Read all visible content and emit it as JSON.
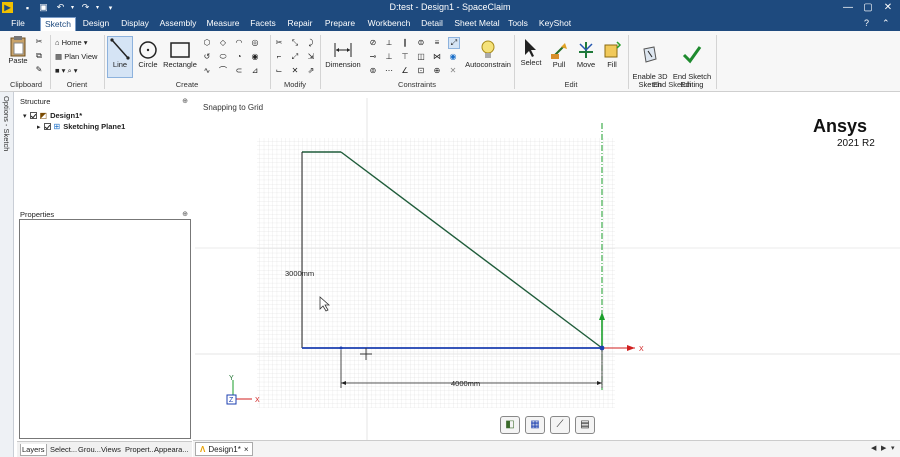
{
  "window": {
    "title": "D:test - Design1 - SpaceClaim"
  },
  "colors": {
    "titlebar": "#1e4a7e",
    "accent_blue": "#1b3fb0",
    "sketch_green": "#1f5c3a",
    "axis_red": "#d01f1f",
    "axis_green": "#1a9e2a",
    "grid": "#d8d8d8"
  },
  "quick_access": [
    "app-icon",
    "new-file-icon",
    "save-icon",
    "undo-icon",
    "redo-icon",
    "customize-icon"
  ],
  "menu": {
    "tabs": [
      "File",
      "Sketch",
      "Design",
      "Display",
      "Assembly",
      "Measure",
      "Facets",
      "Repair",
      "Prepare",
      "Workbench",
      "Detail",
      "Sheet Metal",
      "Tools",
      "KeyShot"
    ],
    "active": "Sketch"
  },
  "ribbon": {
    "clipboard": {
      "label": "Clipboard",
      "paste": "Paste"
    },
    "orient": {
      "label": "Orient",
      "home": "Home",
      "plan_view": "Plan View"
    },
    "create": {
      "label": "Create",
      "line": "Line",
      "circle": "Circle",
      "rectangle": "Rectangle"
    },
    "modify": {
      "label": "Modify"
    },
    "constraints": {
      "label": "Constraints",
      "dimension": "Dimension",
      "autoconstrain": "Autoconstrain"
    },
    "edit": {
      "label": "Edit",
      "select": "Select",
      "pull": "Pull",
      "move": "Move",
      "fill": "Fill"
    },
    "end_sketch": {
      "label": "End Sketch",
      "enable_3d": "Enable 3D\nSketch",
      "end_editing": "End Sketch\nEditing"
    }
  },
  "sidebar": {
    "vertical_tab": "Options - Sketch"
  },
  "structure": {
    "title": "Structure",
    "items": [
      {
        "label": "Design1*"
      },
      {
        "label": "Sketching Plane1"
      }
    ]
  },
  "properties": {
    "title": "Properties"
  },
  "bottom_tabs": [
    "Layers",
    "Select...",
    "Grou...",
    "Views",
    "Propert...",
    "Appeara..."
  ],
  "viewport": {
    "status": "Snapping to Grid",
    "brand": "Ansys",
    "version": "2021 R2",
    "dim_vertical": "3000mm",
    "dim_horizontal": "4000mm",
    "axis_labels": {
      "x": "X",
      "y": "Y",
      "z": "Z"
    }
  },
  "viewport_tools": [
    "solid-view-icon",
    "sketch-mode-icon",
    "section-icon",
    "mini-toolbar-icon"
  ],
  "document_tab": {
    "label": "Design1*",
    "close": "×"
  }
}
